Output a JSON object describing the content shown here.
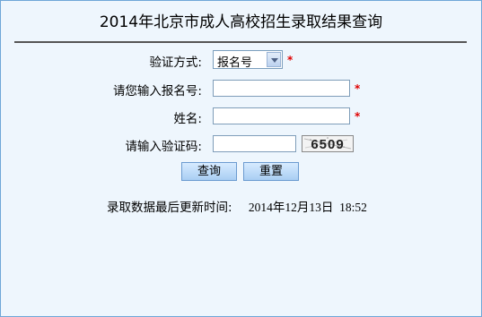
{
  "title": "2014年北京市成人高校招生录取结果查询",
  "form": {
    "method_label": "验证方式:",
    "method_value": "报名号",
    "reg_label": "请您输入报名号:",
    "reg_value": "",
    "name_label": "姓名:",
    "name_value": "",
    "code_label": "请输入验证码:",
    "code_value": "",
    "captcha_text": "6509",
    "required_mark": "*"
  },
  "buttons": {
    "query": "查询",
    "reset": "重置"
  },
  "update": {
    "label": "录取数据最后更新时间:",
    "time": "2014年12月13日  18:52"
  },
  "colors": {
    "panel_border": "#6fa7d8",
    "panel_bg": "#eef6fd",
    "required": "#e00000"
  }
}
